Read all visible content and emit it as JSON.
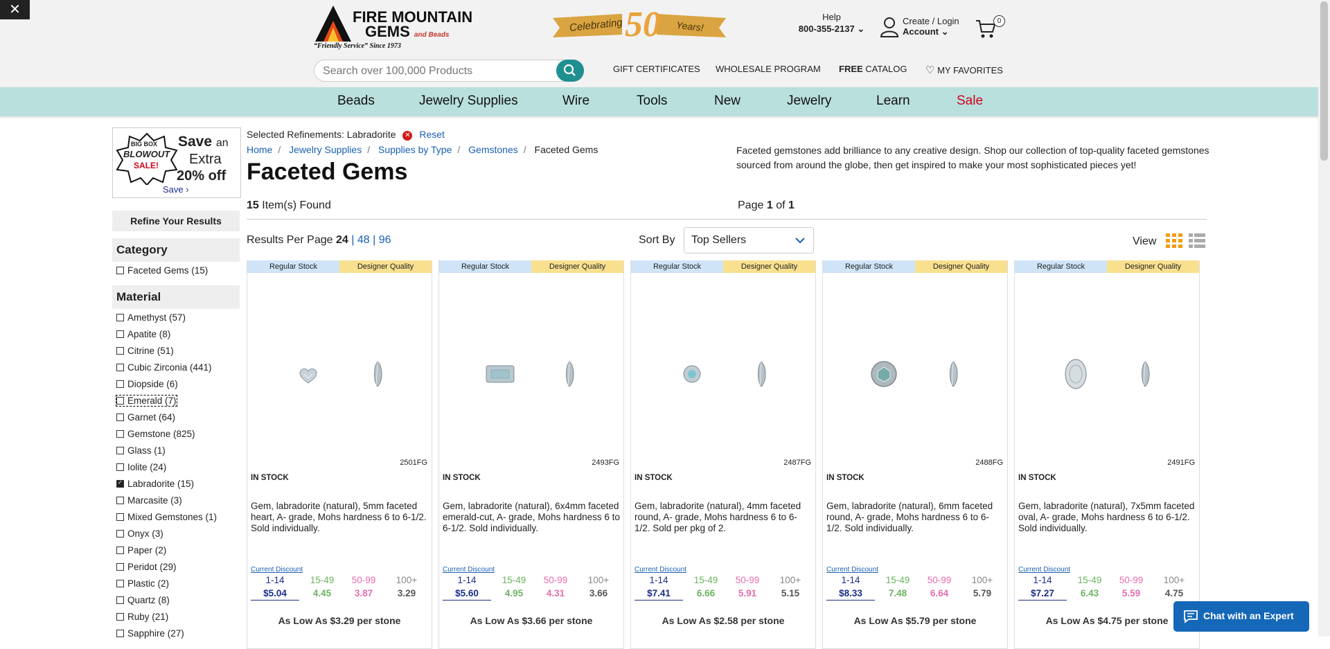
{
  "header": {
    "logo_line1": "FIRE MOUNTAIN",
    "logo_line2": "GEMS",
    "logo_and_beads": "and Beads",
    "logo_tagline": "“Friendly Service” Since 1973",
    "celebrating": "Celebrating",
    "fifty": "50",
    "years": "Years!",
    "help_label": "Help",
    "phone": "800-355-2137",
    "create_login": "Create / Login",
    "account": "Account",
    "cart_count": "0",
    "search_placeholder": "Search over 100,000 Products",
    "gift": "GIFT CERTIFICATES",
    "wholesale": "WHOLESALE PROGRAM",
    "free": "FREE",
    "catalog": "CATALOG",
    "favorites": "MY FAVORITES"
  },
  "nav": [
    "Beads",
    "Jewelry Supplies",
    "Wire",
    "Tools",
    "New",
    "Jewelry",
    "Learn",
    "Sale"
  ],
  "nav_sale_color": "#d0021b",
  "promo": {
    "line1": "Save",
    "an": "an",
    "line2": "Extra",
    "line3": "20% off",
    "link": "Save ›",
    "badge1": "BIG BOX",
    "badge2": "BLOWOUT",
    "badge3": "SALE!"
  },
  "sidebar": {
    "refine": "Refine Your Results",
    "category_head": "Category",
    "categories": [
      "Faceted Gems (15)"
    ],
    "material_head": "Material",
    "materials": [
      "Amethyst (57)",
      "Apatite (8)",
      "Citrine (51)",
      "Cubic Zirconia (441)",
      "Diopside (6)",
      "Emerald (7)",
      "Garnet (64)",
      "Gemstone (825)",
      "Glass (1)",
      "Iolite (24)",
      "Labradorite (15)",
      "Marcasite (3)",
      "Mixed Gemstones (1)",
      "Onyx (3)",
      "Paper (2)",
      "Peridot (29)",
      "Plastic (2)",
      "Quartz (8)",
      "Ruby (21)",
      "Sapphire (27)"
    ],
    "checked_material": "Labradorite (15)"
  },
  "main": {
    "selected_label": "Selected Refinements:",
    "selected_value": "Labradorite",
    "reset": "Reset",
    "crumbs": [
      "Home",
      "Jewelry Supplies",
      "Supplies by Type",
      "Gemstones",
      "Faceted Gems"
    ],
    "title": "Faceted Gems",
    "description": "Faceted gemstones add brilliance to any creative design. Shop our collection of top-quality faceted gemstones sourced from around the globe, then get inspired to make your most sophisticated pieces yet!",
    "found_count": "15",
    "found_label": "Item(s) Found",
    "page_label": "Page",
    "page_current": "1",
    "page_of": "of",
    "page_total": "1",
    "per_page_label": "Results Per Page",
    "per_page_options": [
      "24",
      "48",
      "96"
    ],
    "sort_label": "Sort By",
    "sort_value": "Top Sellers",
    "view_label": "View"
  },
  "products": [
    {
      "sku": "2501FG",
      "stock": "IN STOCK",
      "desc": "Gem, labradorite (natural), 5mm faceted heart, A- grade, Mohs hardness 6 to 6-1/2. Sold individually.",
      "prices": [
        "$5.04",
        "4.45",
        "3.87",
        "3.29"
      ],
      "as_low": "As Low As $3.29 per stone",
      "shape": "heart"
    },
    {
      "sku": "2493FG",
      "stock": "IN STOCK",
      "desc": "Gem, labradorite (natural), 6x4mm faceted emerald-cut, A- grade, Mohs hardness 6 to 6-1/2. Sold individually.",
      "prices": [
        "$5.60",
        "4.95",
        "4.31",
        "3.66"
      ],
      "as_low": "As Low As $3.66 per stone",
      "shape": "emerald"
    },
    {
      "sku": "2487FG",
      "stock": "IN STOCK",
      "desc": "Gem, labradorite (natural), 4mm faceted round, A- grade, Mohs hardness 6 to 6-1/2. Sold per pkg of 2.",
      "prices": [
        "$7.41",
        "6.66",
        "5.91",
        "5.15"
      ],
      "as_low": "As Low As $2.58 per stone",
      "shape": "round-small"
    },
    {
      "sku": "2488FG",
      "stock": "IN STOCK",
      "desc": "Gem, labradorite (natural), 6mm faceted round, A- grade, Mohs hardness 6 to 6-1/2. Sold individually.",
      "prices": [
        "$8.33",
        "7.48",
        "6.64",
        "5.79"
      ],
      "as_low": "As Low As $5.79 per stone",
      "shape": "round"
    },
    {
      "sku": "2491FG",
      "stock": "IN STOCK",
      "desc": "Gem, labradorite (natural), 7x5mm faceted oval, A- grade, Mohs hardness 6 to 6-1/2. Sold individually.",
      "prices": [
        "$7.27",
        "6.43",
        "5.59",
        "4.75"
      ],
      "as_low": "As Low As $4.75 per stone",
      "shape": "oval"
    }
  ],
  "product_common": {
    "tag_regular": "Regular Stock",
    "tag_designer": "Designer Quality",
    "current_discount": "Current Discount",
    "tiers": [
      "1-14",
      "15-49",
      "50-99",
      "100+"
    ]
  },
  "chat": "Chat with an Expert"
}
